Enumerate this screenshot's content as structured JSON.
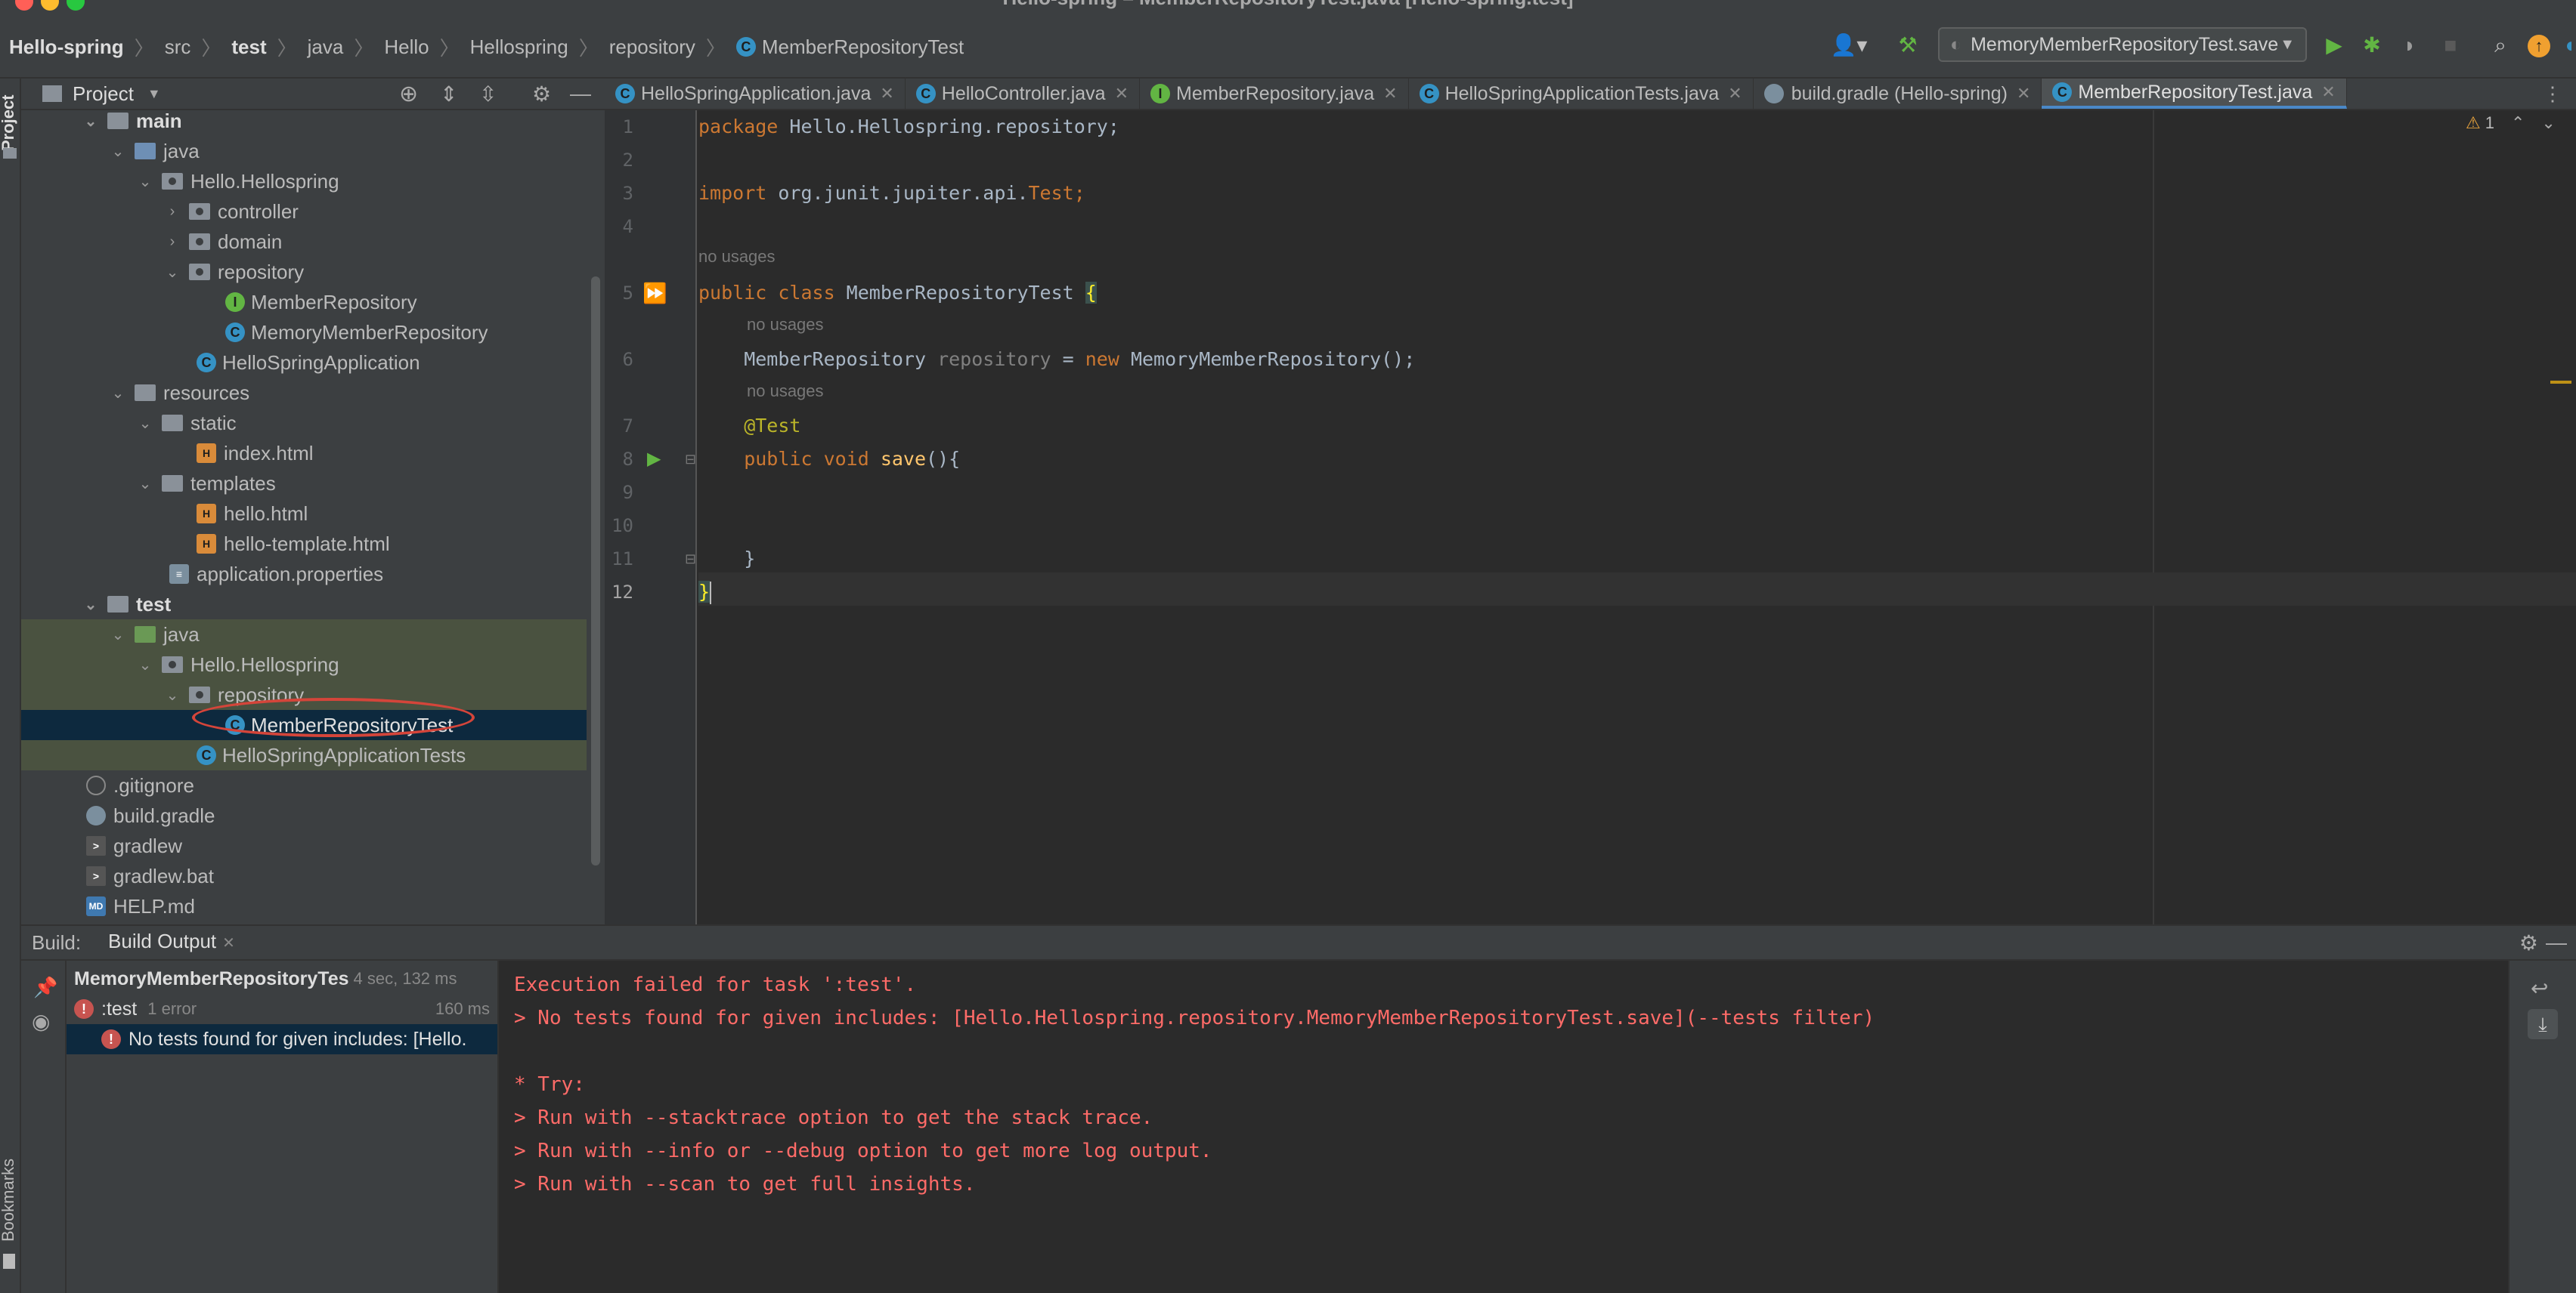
{
  "window": {
    "title": "Hello-spring – MemberRepositoryTest.java [Hello-spring.test]"
  },
  "breadcrumbs": [
    {
      "label": "Hello-spring",
      "bold": true
    },
    {
      "label": "src"
    },
    {
      "label": "test",
      "bold": true
    },
    {
      "label": "java"
    },
    {
      "label": "Hello"
    },
    {
      "label": "Hellospring"
    },
    {
      "label": "repository"
    },
    {
      "label": "MemberRepositoryTest",
      "icon": "class"
    }
  ],
  "toolbar": {
    "run_config": "MemoryMemberRepositoryTest.save"
  },
  "left_strip": {
    "project": "Project",
    "bookmarks": "Bookmarks"
  },
  "project_panel": {
    "title": "Project"
  },
  "tree": [
    {
      "label": "main",
      "bold": true
    },
    {
      "label": "java"
    },
    {
      "label": "Hello.Hellospring"
    },
    {
      "label": "controller"
    },
    {
      "label": "domain"
    },
    {
      "label": "repository"
    },
    {
      "label": "MemberRepository"
    },
    {
      "label": "MemoryMemberRepository"
    },
    {
      "label": "HelloSpringApplication"
    },
    {
      "label": "resources"
    },
    {
      "label": "static"
    },
    {
      "label": "index.html"
    },
    {
      "label": "templates"
    },
    {
      "label": "hello.html"
    },
    {
      "label": "hello-template.html"
    },
    {
      "label": "application.properties"
    },
    {
      "label": "test",
      "bold": true
    },
    {
      "label": "java"
    },
    {
      "label": "Hello.Hellospring"
    },
    {
      "label": "repository"
    },
    {
      "label": "MemberRepositoryTest"
    },
    {
      "label": "HelloSpringApplicationTests"
    },
    {
      "label": ".gitignore"
    },
    {
      "label": "build.gradle"
    },
    {
      "label": "gradlew"
    },
    {
      "label": "gradlew.bat"
    },
    {
      "label": "HELP.md"
    }
  ],
  "editor_tabs": [
    {
      "label": "HelloSpringApplication.java"
    },
    {
      "label": "HelloController.java"
    },
    {
      "label": "MemberRepository.java"
    },
    {
      "label": "HelloSpringApplicationTests.java"
    },
    {
      "label": "build.gradle (Hello-spring)"
    },
    {
      "label": "MemberRepositoryTest.java",
      "active": true
    }
  ],
  "editor": {
    "line_numbers": [
      "1",
      "2",
      "3",
      "4",
      "5",
      "6",
      "7",
      "8",
      "9",
      "10",
      "11",
      "12"
    ],
    "hint_no_usages": "no usages",
    "warnings_count": "1",
    "code": {
      "l1_kw": "package",
      "l1_rest": " Hello.Hellospring.repository;",
      "l3_kw": "import",
      "l3_rest": " org.junit.jupiter.api.",
      "l3_cls": "Test",
      "l3_end": ";",
      "l5_kw": "public class",
      "l5_name": " MemberRepositoryTest ",
      "l5_brace": "{",
      "l6_type": "    MemberRepository ",
      "l6_var": "repository",
      "l6_eq": " = ",
      "l6_new": "new",
      "l6_rest": " MemoryMemberRepository();",
      "l7_ann": "    @Test",
      "l8_kw": "    public void ",
      "l8_fn": "save",
      "l8_rest": "(){",
      "l11": "    }",
      "l12": "}"
    }
  },
  "build": {
    "label": "Build:",
    "tab": "Build Output",
    "tree": [
      {
        "label": "MemoryMemberRepositoryTes",
        "time": "4 sec, 132 ms"
      },
      {
        "label": ":test",
        "detail": "1 error",
        "time": "160 ms"
      },
      {
        "label": "No tests found for given includes: [Hello."
      }
    ],
    "console": [
      "Execution failed for task ':test'.",
      "> No tests found for given includes: [Hello.Hellospring.repository.MemoryMemberRepositoryTest.save](--tests filter)",
      "",
      "* Try:",
      "> Run with --stacktrace option to get the stack trace.",
      "> Run with --info or --debug option to get more log output.",
      "> Run with --scan to get full insights."
    ]
  },
  "colors": {
    "accent": "#4a88c7",
    "error": "#ff6b68",
    "annotation_circle": "#d4453a"
  }
}
